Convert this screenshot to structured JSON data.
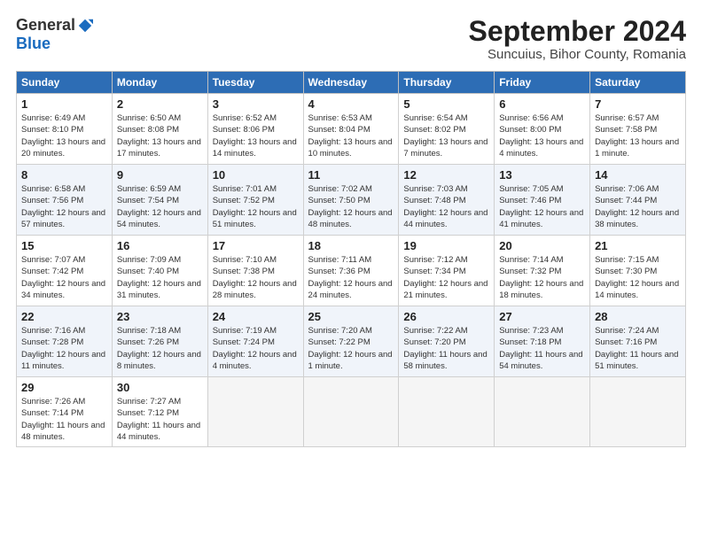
{
  "header": {
    "logo_general": "General",
    "logo_blue": "Blue",
    "month_title": "September 2024",
    "location": "Suncuius, Bihor County, Romania"
  },
  "weekdays": [
    "Sunday",
    "Monday",
    "Tuesday",
    "Wednesday",
    "Thursday",
    "Friday",
    "Saturday"
  ],
  "days": [
    {
      "date": "",
      "info": ""
    },
    {
      "date": "",
      "info": ""
    },
    {
      "date": "",
      "info": ""
    },
    {
      "date": "",
      "info": ""
    },
    {
      "date": "",
      "info": ""
    },
    {
      "date": "",
      "info": ""
    },
    {
      "date": "1",
      "sunrise": "Sunrise: 6:49 AM",
      "sunset": "Sunset: 8:10 PM",
      "daylight": "Daylight: 13 hours and 20 minutes."
    },
    {
      "date": "2",
      "sunrise": "Sunrise: 6:50 AM",
      "sunset": "Sunset: 8:08 PM",
      "daylight": "Daylight: 13 hours and 17 minutes."
    },
    {
      "date": "3",
      "sunrise": "Sunrise: 6:52 AM",
      "sunset": "Sunset: 8:06 PM",
      "daylight": "Daylight: 13 hours and 14 minutes."
    },
    {
      "date": "4",
      "sunrise": "Sunrise: 6:53 AM",
      "sunset": "Sunset: 8:04 PM",
      "daylight": "Daylight: 13 hours and 10 minutes."
    },
    {
      "date": "5",
      "sunrise": "Sunrise: 6:54 AM",
      "sunset": "Sunset: 8:02 PM",
      "daylight": "Daylight: 13 hours and 7 minutes."
    },
    {
      "date": "6",
      "sunrise": "Sunrise: 6:56 AM",
      "sunset": "Sunset: 8:00 PM",
      "daylight": "Daylight: 13 hours and 4 minutes."
    },
    {
      "date": "7",
      "sunrise": "Sunrise: 6:57 AM",
      "sunset": "Sunset: 7:58 PM",
      "daylight": "Daylight: 13 hours and 1 minute."
    },
    {
      "date": "8",
      "sunrise": "Sunrise: 6:58 AM",
      "sunset": "Sunset: 7:56 PM",
      "daylight": "Daylight: 12 hours and 57 minutes."
    },
    {
      "date": "9",
      "sunrise": "Sunrise: 6:59 AM",
      "sunset": "Sunset: 7:54 PM",
      "daylight": "Daylight: 12 hours and 54 minutes."
    },
    {
      "date": "10",
      "sunrise": "Sunrise: 7:01 AM",
      "sunset": "Sunset: 7:52 PM",
      "daylight": "Daylight: 12 hours and 51 minutes."
    },
    {
      "date": "11",
      "sunrise": "Sunrise: 7:02 AM",
      "sunset": "Sunset: 7:50 PM",
      "daylight": "Daylight: 12 hours and 48 minutes."
    },
    {
      "date": "12",
      "sunrise": "Sunrise: 7:03 AM",
      "sunset": "Sunset: 7:48 PM",
      "daylight": "Daylight: 12 hours and 44 minutes."
    },
    {
      "date": "13",
      "sunrise": "Sunrise: 7:05 AM",
      "sunset": "Sunset: 7:46 PM",
      "daylight": "Daylight: 12 hours and 41 minutes."
    },
    {
      "date": "14",
      "sunrise": "Sunrise: 7:06 AM",
      "sunset": "Sunset: 7:44 PM",
      "daylight": "Daylight: 12 hours and 38 minutes."
    },
    {
      "date": "15",
      "sunrise": "Sunrise: 7:07 AM",
      "sunset": "Sunset: 7:42 PM",
      "daylight": "Daylight: 12 hours and 34 minutes."
    },
    {
      "date": "16",
      "sunrise": "Sunrise: 7:09 AM",
      "sunset": "Sunset: 7:40 PM",
      "daylight": "Daylight: 12 hours and 31 minutes."
    },
    {
      "date": "17",
      "sunrise": "Sunrise: 7:10 AM",
      "sunset": "Sunset: 7:38 PM",
      "daylight": "Daylight: 12 hours and 28 minutes."
    },
    {
      "date": "18",
      "sunrise": "Sunrise: 7:11 AM",
      "sunset": "Sunset: 7:36 PM",
      "daylight": "Daylight: 12 hours and 24 minutes."
    },
    {
      "date": "19",
      "sunrise": "Sunrise: 7:12 AM",
      "sunset": "Sunset: 7:34 PM",
      "daylight": "Daylight: 12 hours and 21 minutes."
    },
    {
      "date": "20",
      "sunrise": "Sunrise: 7:14 AM",
      "sunset": "Sunset: 7:32 PM",
      "daylight": "Daylight: 12 hours and 18 minutes."
    },
    {
      "date": "21",
      "sunrise": "Sunrise: 7:15 AM",
      "sunset": "Sunset: 7:30 PM",
      "daylight": "Daylight: 12 hours and 14 minutes."
    },
    {
      "date": "22",
      "sunrise": "Sunrise: 7:16 AM",
      "sunset": "Sunset: 7:28 PM",
      "daylight": "Daylight: 12 hours and 11 minutes."
    },
    {
      "date": "23",
      "sunrise": "Sunrise: 7:18 AM",
      "sunset": "Sunset: 7:26 PM",
      "daylight": "Daylight: 12 hours and 8 minutes."
    },
    {
      "date": "24",
      "sunrise": "Sunrise: 7:19 AM",
      "sunset": "Sunset: 7:24 PM",
      "daylight": "Daylight: 12 hours and 4 minutes."
    },
    {
      "date": "25",
      "sunrise": "Sunrise: 7:20 AM",
      "sunset": "Sunset: 7:22 PM",
      "daylight": "Daylight: 12 hours and 1 minute."
    },
    {
      "date": "26",
      "sunrise": "Sunrise: 7:22 AM",
      "sunset": "Sunset: 7:20 PM",
      "daylight": "Daylight: 11 hours and 58 minutes."
    },
    {
      "date": "27",
      "sunrise": "Sunrise: 7:23 AM",
      "sunset": "Sunset: 7:18 PM",
      "daylight": "Daylight: 11 hours and 54 minutes."
    },
    {
      "date": "28",
      "sunrise": "Sunrise: 7:24 AM",
      "sunset": "Sunset: 7:16 PM",
      "daylight": "Daylight: 11 hours and 51 minutes."
    },
    {
      "date": "29",
      "sunrise": "Sunrise: 7:26 AM",
      "sunset": "Sunset: 7:14 PM",
      "daylight": "Daylight: 11 hours and 48 minutes."
    },
    {
      "date": "30",
      "sunrise": "Sunrise: 7:27 AM",
      "sunset": "Sunset: 7:12 PM",
      "daylight": "Daylight: 11 hours and 44 minutes."
    }
  ]
}
